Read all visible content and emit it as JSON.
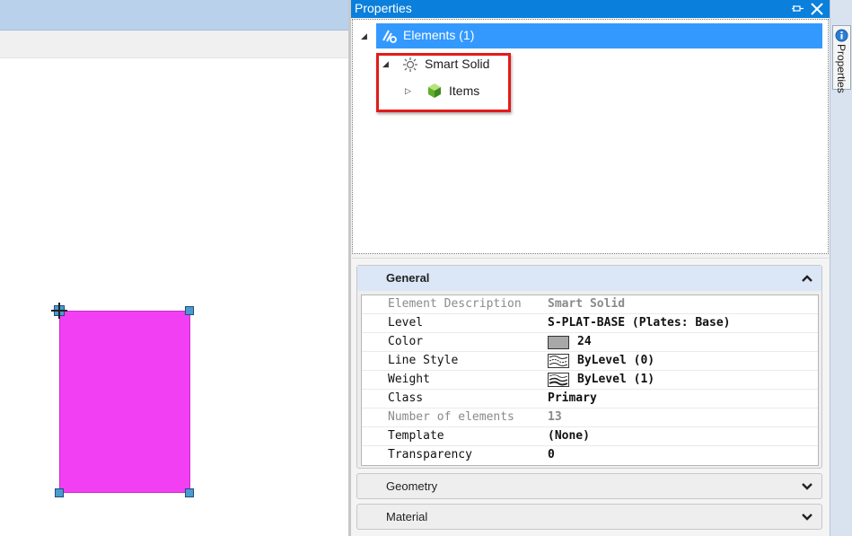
{
  "panel": {
    "title": "Properties",
    "side_tab_label": "Properties"
  },
  "tree": {
    "items": [
      {
        "label": "Elements (1)",
        "icon": "elements-icon",
        "expanded": true,
        "selected": true
      },
      {
        "label": "Smart Solid",
        "icon": "smart-solid-icon",
        "expanded": true
      },
      {
        "label": "Items",
        "icon": "items-cube-icon",
        "expanded": false
      }
    ]
  },
  "sections": [
    {
      "label": "General",
      "open": true
    },
    {
      "label": "Geometry",
      "open": false
    },
    {
      "label": "Material",
      "open": false
    }
  ],
  "general": {
    "rows": [
      {
        "name": "Element Description",
        "value": "Smart Solid",
        "readonly": true
      },
      {
        "name": "Level",
        "value": "S-PLAT-BASE (Plates: Base)"
      },
      {
        "name": "Color",
        "value": "24",
        "swatch": "#a8a8a8"
      },
      {
        "name": "Line Style",
        "value": "ByLevel (0)",
        "icon": "line-style-icon"
      },
      {
        "name": "Weight",
        "value": "ByLevel (1)",
        "icon": "weight-icon"
      },
      {
        "name": "Class",
        "value": "Primary"
      },
      {
        "name": "Number of elements",
        "value": "13",
        "readonly": true
      },
      {
        "name": "Template",
        "value": "(None)"
      },
      {
        "name": "Transparency",
        "value": "0"
      }
    ]
  },
  "colors": {
    "shape_fill": "#f33ff4",
    "panel_header": "#0a7fdc",
    "selection": "#3399ff",
    "highlight_box": "#e21b1b"
  }
}
